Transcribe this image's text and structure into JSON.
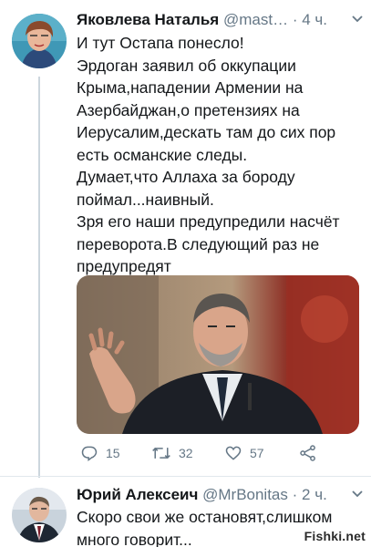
{
  "tweets": [
    {
      "author_name": "Яковлева Наталья",
      "handle": "@mast…",
      "dot": "·",
      "time": "4 ч.",
      "text_lines": [
        "И тут Остапа понесло!",
        "Эрдоган заявил об оккупации",
        "Крыма,нападении Армении на",
        "Азербайджан,о претензиях на",
        "Иерусалим,дескать там до сих пор",
        "есть османские следы.",
        "Думает,что Аллаха за бороду",
        "поймал...наивный.",
        "Зря его наши предупредили насчёт",
        "переворота.В следующий раз не",
        "предупредят"
      ],
      "stats": {
        "replies": "15",
        "retweets": "32",
        "likes": "57"
      }
    },
    {
      "author_name": "Юрий Алексеич",
      "handle": "@MrBonitas",
      "dot": "·",
      "time": "2 ч.",
      "text_lines": [
        "Скоро свои же остановят,слишком",
        "много говорит..."
      ]
    }
  ],
  "watermark": "Fishki.net",
  "icons": {
    "reply": "reply-icon",
    "retweet": "retweet-icon",
    "like": "heart-icon",
    "share": "share-icon",
    "more": "chevron-down-icon"
  },
  "colors": {
    "text": "#14171a",
    "muted": "#657786",
    "divider": "#e1e8ed"
  }
}
